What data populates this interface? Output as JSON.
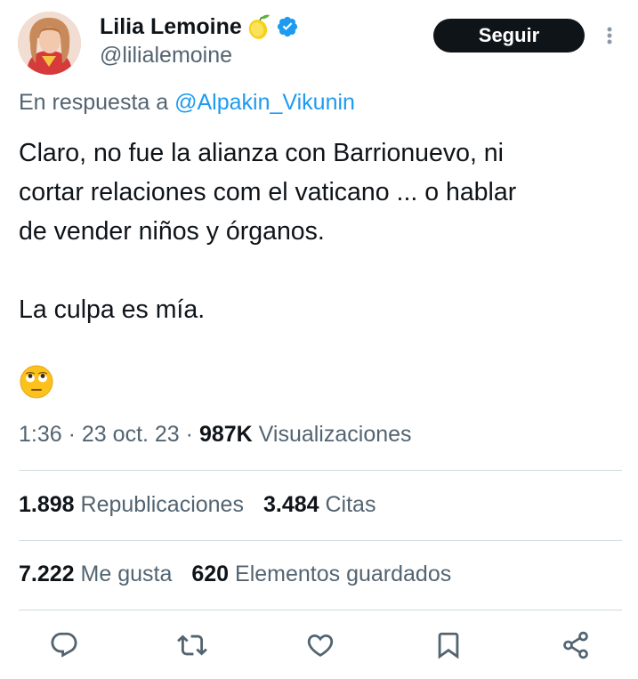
{
  "author": {
    "display_name": "Lilia Lemoine",
    "handle": "@lilialemoine",
    "badge_emoji": "lemon-icon",
    "verified": true
  },
  "header": {
    "follow_label": "Seguir"
  },
  "reply": {
    "prefix": "En respuesta a",
    "handle": "@Alpakin_Vikunin"
  },
  "tweet": {
    "lines": [
      "Claro, no fue la alianza con Barrionuevo, ni",
      "cortar relaciones com el vaticano ... o hablar",
      "de vender niños y órganos.",
      "La culpa es mía."
    ],
    "emoji": "eye-roll-emoji"
  },
  "meta": {
    "time": "1:36",
    "date": "23 oct. 23",
    "views_count": "987K",
    "views_label": "Visualizaciones"
  },
  "stats": {
    "retweets_count": "1.898",
    "retweets_label": "Republicaciones",
    "quotes_count": "3.484",
    "quotes_label": "Citas",
    "likes_count": "7.222",
    "likes_label": "Me gusta",
    "bookmarks_count": "620",
    "bookmarks_label": "Elementos guardados"
  },
  "colors": {
    "text": "#0f1419",
    "secondary": "#536471",
    "link": "#1d9bf0",
    "divider": "#cfd9de",
    "verified": "#1d9bf0"
  }
}
